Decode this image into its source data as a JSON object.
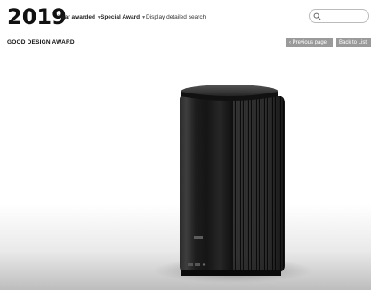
{
  "header": {
    "year": "2019",
    "filter_year": {
      "label": "Year awarded",
      "icon": "chevron-down-icon"
    },
    "filter_award": {
      "label": "Special Award",
      "icon": "chevron-down-icon"
    },
    "detail_link": "Display detailed search",
    "search": {
      "placeholder": "",
      "value": "",
      "icon": "search-icon"
    }
  },
  "content": {
    "title": "GOOD DESIGN AWARD",
    "prev_button": "‹ Previous page",
    "back_button": "Back to List"
  },
  "photo": {
    "subject": "product-photo",
    "brand_mark": "ASUS"
  },
  "colors": {
    "button_bg": "#9a9a9a",
    "button_text": "#ffffff",
    "product_body": "#1c1c1c"
  }
}
